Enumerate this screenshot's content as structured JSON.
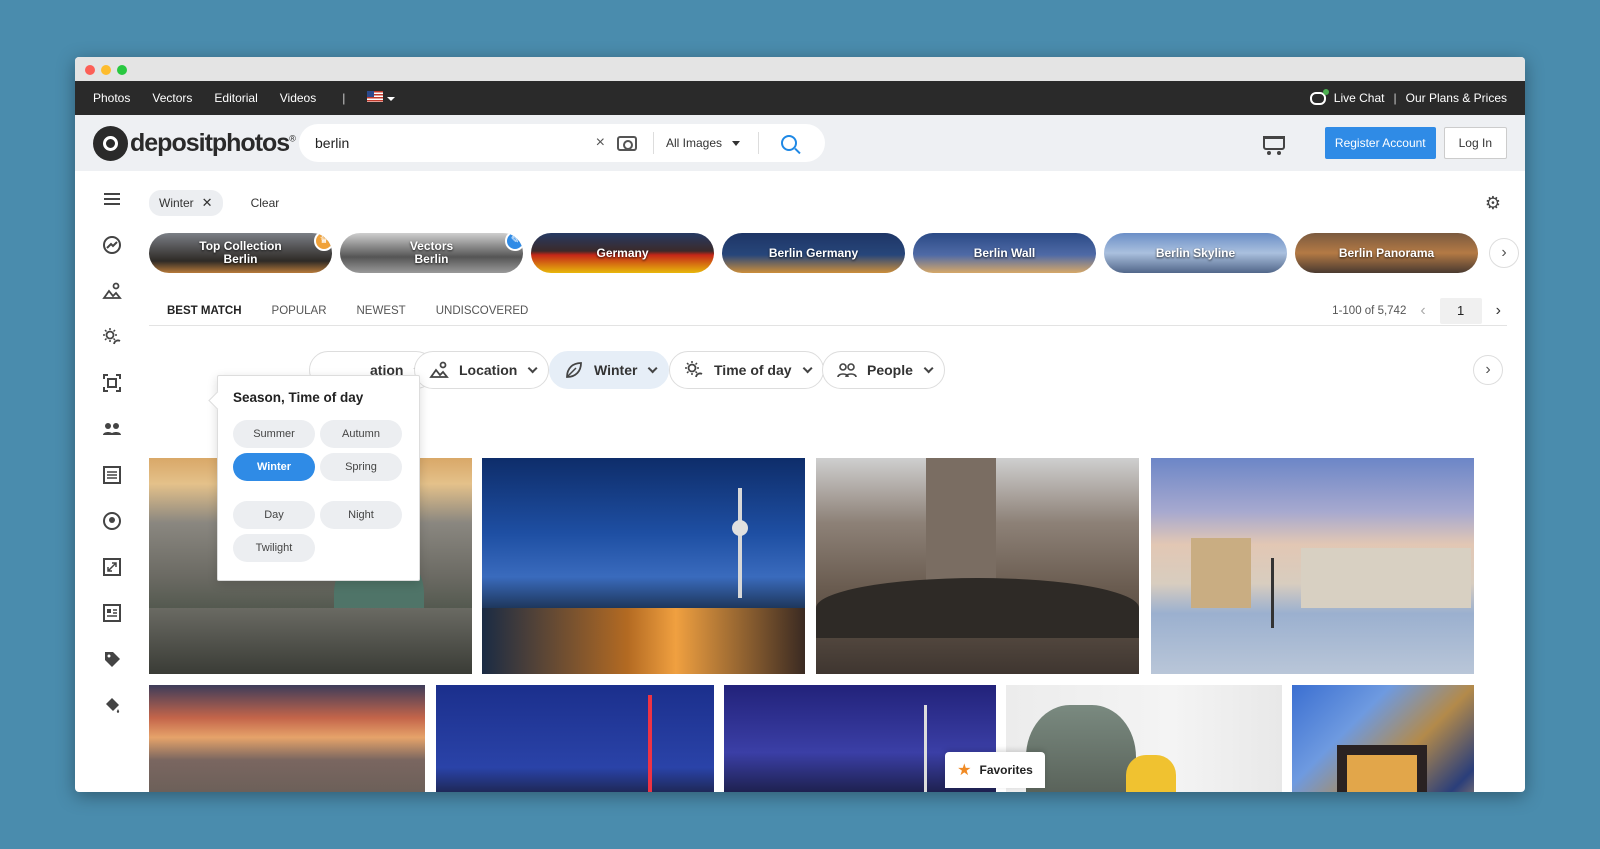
{
  "topnav": {
    "links": [
      "Photos",
      "Vectors",
      "Editorial",
      "Videos"
    ],
    "separator": "|",
    "live_chat": "Live Chat",
    "pipe": "|",
    "plans": "Our Plans & Prices"
  },
  "header": {
    "logo_text": "depositphotos",
    "logo_reg": "®",
    "search_value": "berlin",
    "search_clear": "×",
    "type_label": "All Images",
    "register": "Register Account",
    "login": "Log In"
  },
  "filters": {
    "chip": "Winter",
    "chip_x": "✕",
    "clear": "Clear"
  },
  "collections": [
    {
      "label_line1": "Top Collection",
      "label_line2": "Berlin",
      "badge": "crown"
    },
    {
      "label_line1": "Vectors",
      "label_line2": "Berlin",
      "badge": "pen"
    },
    {
      "label_line1": "Germany",
      "label_line2": ""
    },
    {
      "label_line1": "Berlin Germany",
      "label_line2": ""
    },
    {
      "label_line1": "Berlin Wall",
      "label_line2": ""
    },
    {
      "label_line1": "Berlin Skyline",
      "label_line2": ""
    },
    {
      "label_line1": "Berlin Panorama",
      "label_line2": ""
    }
  ],
  "sort": {
    "tabs": [
      "BEST MATCH",
      "POPULAR",
      "NEWEST",
      "UNDISCOVERED"
    ],
    "active": "BEST MATCH",
    "results": "1-100 of 5,742",
    "page": "1"
  },
  "facets": [
    {
      "label": "ation",
      "icon": "orientation-icon"
    },
    {
      "label": "Location",
      "icon": "location-icon"
    },
    {
      "label": "Winter",
      "icon": "season-icon",
      "active": true
    },
    {
      "label": "Time of day",
      "icon": "time-of-day-icon"
    },
    {
      "label": "People",
      "icon": "people-icon"
    }
  ],
  "popover": {
    "title": "Season, Time of day",
    "seasons": [
      "Summer",
      "Autumn",
      "Winter",
      "Spring"
    ],
    "selected": "Winter",
    "times": [
      "Day",
      "Night",
      "Twilight"
    ]
  },
  "favorites": "Favorites",
  "colors": {
    "accent": "#2f8be6",
    "topbar": "#2a2a2a",
    "header_bg": "#eef0f3",
    "page_bg": "#4a8cad"
  }
}
